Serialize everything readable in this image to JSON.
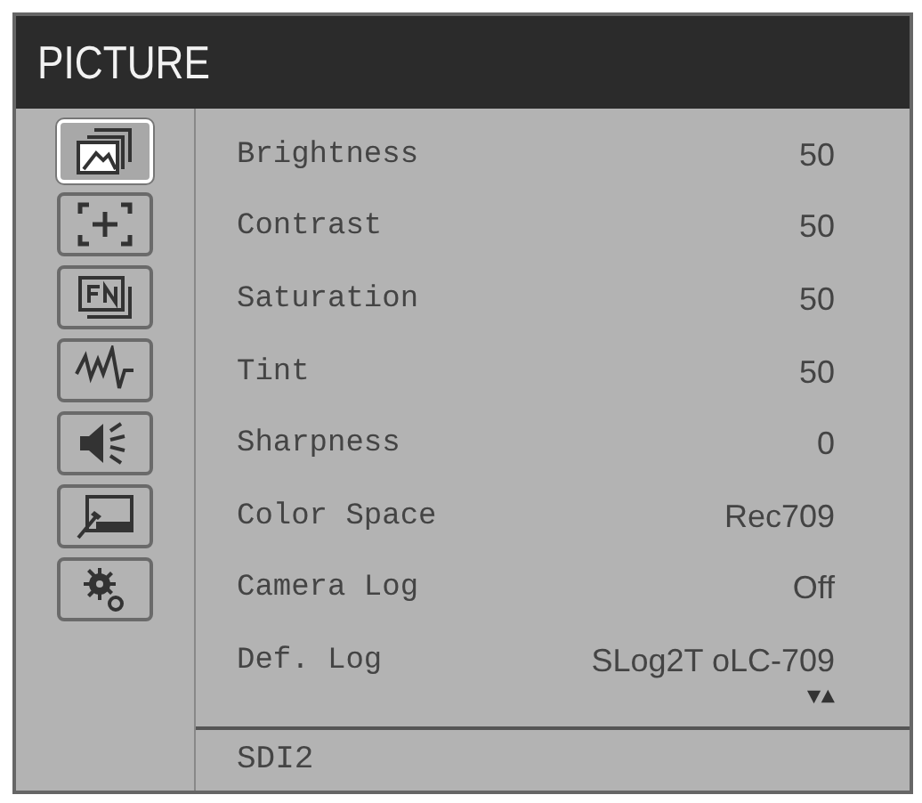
{
  "window": {
    "title": "PICTURE"
  },
  "sidebar": {
    "items": [
      {
        "kind": "picture",
        "selected": true
      },
      {
        "kind": "marker",
        "selected": false
      },
      {
        "kind": "function",
        "selected": false
      },
      {
        "kind": "waveform",
        "selected": false
      },
      {
        "kind": "audio",
        "selected": false
      },
      {
        "kind": "setup",
        "selected": false
      },
      {
        "kind": "system",
        "selected": false
      }
    ]
  },
  "settings": [
    {
      "label": "Brightness",
      "value": "50"
    },
    {
      "label": "Contrast",
      "value": "50"
    },
    {
      "label": "Saturation",
      "value": "50"
    },
    {
      "label": "Tint",
      "value": "50"
    },
    {
      "label": "Sharpness",
      "value": "0"
    },
    {
      "label": "Color Space",
      "value": "Rec709"
    },
    {
      "label": "Camera Log",
      "value": "Off"
    },
    {
      "label": "Def. Log",
      "value": "SLog2T oLC-709"
    }
  ],
  "scroll_arrows": "▼▲",
  "status_bar": {
    "input": "SDI2"
  }
}
